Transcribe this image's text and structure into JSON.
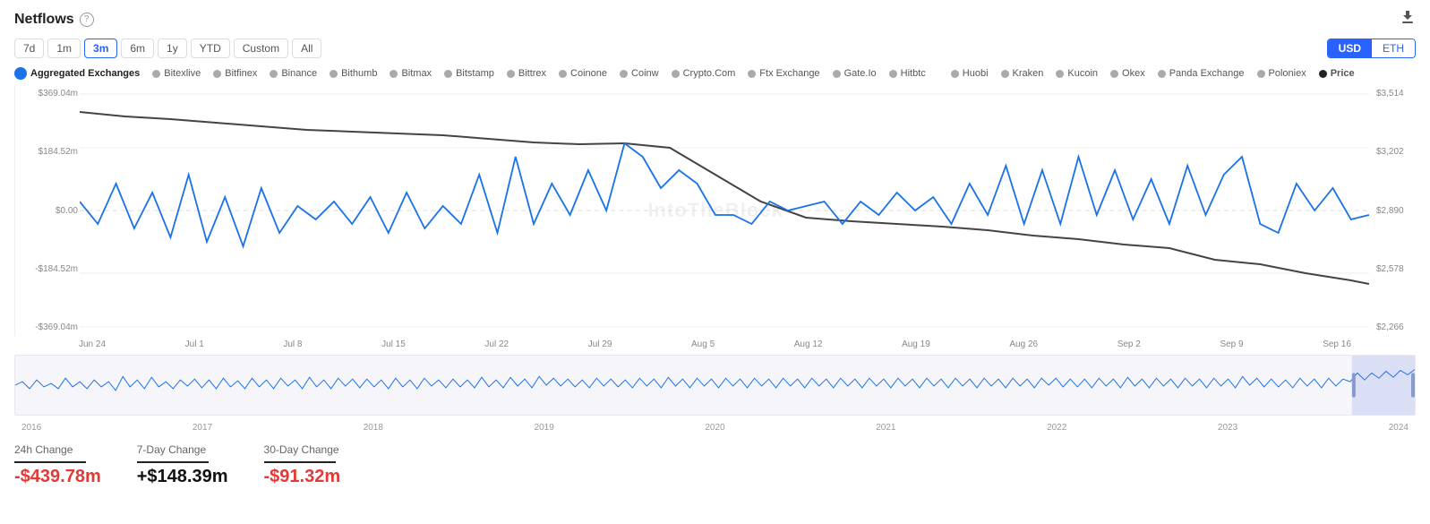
{
  "header": {
    "title": "Netflows",
    "download_label": "⬇"
  },
  "time_buttons": [
    {
      "label": "7d",
      "active": false
    },
    {
      "label": "1m",
      "active": false
    },
    {
      "label": "3m",
      "active": true
    },
    {
      "label": "6m",
      "active": false
    },
    {
      "label": "1y",
      "active": false
    },
    {
      "label": "YTD",
      "active": false
    },
    {
      "label": "Custom",
      "active": false
    },
    {
      "label": "All",
      "active": false
    }
  ],
  "currency_buttons": [
    {
      "label": "USD",
      "active": true
    },
    {
      "label": "ETH",
      "active": false
    }
  ],
  "legend": [
    {
      "label": "Aggregated Exchanges",
      "color": "#1a73e8",
      "primary": true
    },
    {
      "label": "Bitexlive",
      "color": "#aaa"
    },
    {
      "label": "Bitfinex",
      "color": "#aaa"
    },
    {
      "label": "Binance",
      "color": "#aaa"
    },
    {
      "label": "Bithumb",
      "color": "#aaa"
    },
    {
      "label": "Bitmax",
      "color": "#aaa"
    },
    {
      "label": "Bitstamp",
      "color": "#aaa"
    },
    {
      "label": "Bittrex",
      "color": "#aaa"
    },
    {
      "label": "Coinone",
      "color": "#aaa"
    },
    {
      "label": "Coinw",
      "color": "#aaa"
    },
    {
      "label": "Crypto.Com",
      "color": "#aaa"
    },
    {
      "label": "Ftx Exchange",
      "color": "#aaa"
    },
    {
      "label": "Gate.Io",
      "color": "#aaa"
    },
    {
      "label": "Hitbtc",
      "color": "#aaa"
    },
    {
      "label": "Huobi",
      "color": "#aaa"
    },
    {
      "label": "Kraken",
      "color": "#aaa"
    },
    {
      "label": "Kucoin",
      "color": "#aaa"
    },
    {
      "label": "Okex",
      "color": "#aaa"
    },
    {
      "label": "Panda Exchange",
      "color": "#aaa"
    },
    {
      "label": "Poloniex",
      "color": "#aaa"
    },
    {
      "label": "Price",
      "color": "#222"
    }
  ],
  "y_axis": {
    "labels": [
      "$369.04m",
      "$184.52m",
      "$0.00",
      "-$184.52m",
      "-$369.04m"
    ]
  },
  "y_axis_right": {
    "labels": [
      "$3,514",
      "$3,202",
      "$2,890",
      "$2,578",
      "$2,266"
    ]
  },
  "x_axis": {
    "labels": [
      "Jun 24",
      "Jul 1",
      "Jul 8",
      "Jul 15",
      "Jul 22",
      "Jul 29",
      "Aug 5",
      "Aug 12",
      "Aug 19",
      "Aug 26",
      "Sep 2",
      "Sep 9",
      "Sep 16"
    ]
  },
  "mini_x_labels": [
    "2016",
    "2017",
    "2018",
    "2019",
    "2020",
    "2021",
    "2022",
    "2023",
    "2024"
  ],
  "watermark": "IntoTheBlock",
  "stats": [
    {
      "label": "24h Change",
      "value": "-$439.78m",
      "type": "negative"
    },
    {
      "label": "7-Day Change",
      "value": "+$148.39m",
      "type": "positive"
    },
    {
      "label": "30-Day Change",
      "value": "-$91.32m",
      "type": "negative"
    }
  ]
}
